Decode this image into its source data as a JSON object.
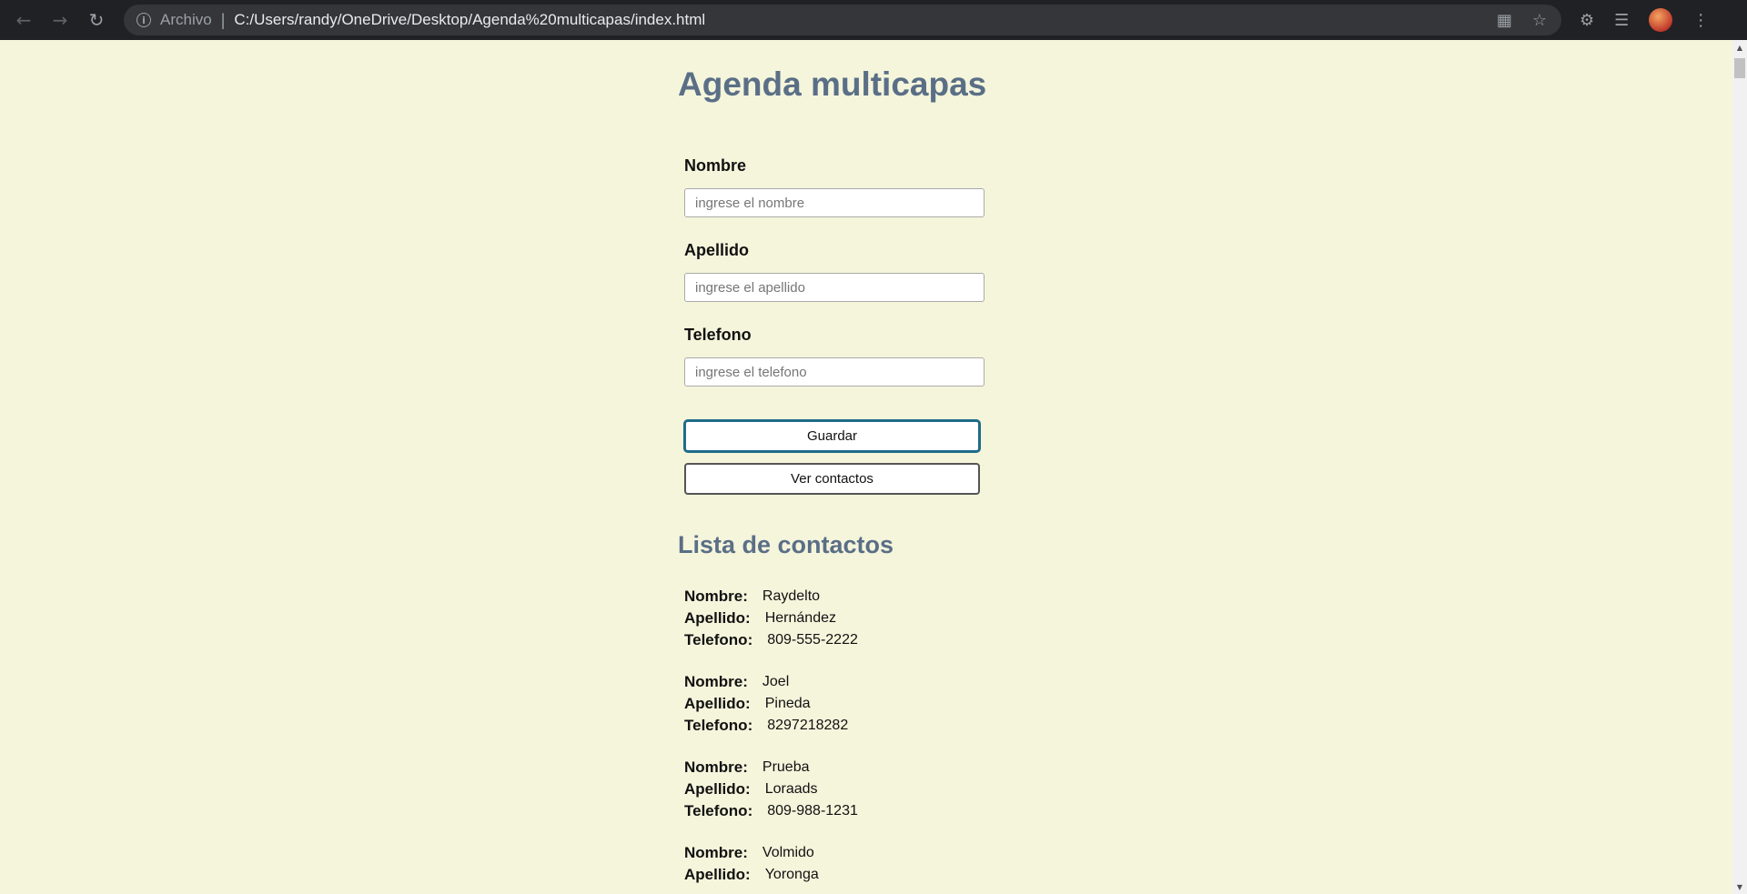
{
  "browser": {
    "scheme_label": "Archivo",
    "url": "C:/Users/randy/OneDrive/Desktop/Agenda%20multicapas/index.html"
  },
  "app": {
    "title": "Agenda multicapas",
    "form": {
      "nombre": {
        "label": "Nombre",
        "placeholder": "ingrese el nombre",
        "value": ""
      },
      "apellido": {
        "label": "Apellido",
        "placeholder": "ingrese el apellido",
        "value": ""
      },
      "telefono": {
        "label": "Telefono",
        "placeholder": "ingrese el telefono",
        "value": ""
      },
      "save_label": "Guardar",
      "view_label": "Ver contactos"
    },
    "list_title": "Lista de contactos",
    "field_keys": {
      "nombre": "Nombre:",
      "apellido": "Apellido:",
      "telefono": "Telefono:"
    },
    "contacts": [
      {
        "nombre": "Raydelto",
        "apellido": "Hernández",
        "telefono": "809-555-2222"
      },
      {
        "nombre": "Joel",
        "apellido": "Pineda",
        "telefono": "8297218282"
      },
      {
        "nombre": "Prueba",
        "apellido": "Loraads",
        "telefono": "809-988-1231"
      },
      {
        "nombre": "Volmido",
        "apellido": "Yoronga",
        "telefono": ""
      }
    ]
  },
  "icons": {
    "back": "arrow-left",
    "forward": "arrow-right",
    "reload": "reload",
    "info": "info-circle",
    "translate": "translate",
    "bookmark": "star",
    "extensions": "puzzle",
    "media": "playlist",
    "menu": "kebab"
  }
}
